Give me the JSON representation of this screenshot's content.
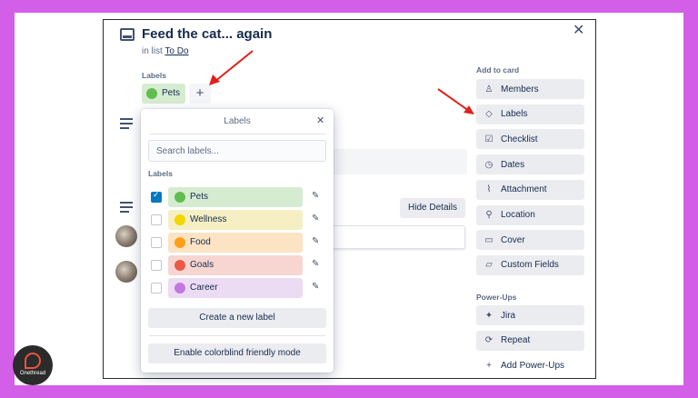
{
  "card": {
    "title": "Feed the cat... again",
    "in_list_prefix": "in list",
    "list_name": "To Do",
    "close_glyph": "✕",
    "labels_heading": "Labels",
    "current_label": "Pets",
    "add_label_glyph": "+",
    "hide_details_label": "Hide Details"
  },
  "sidebar": {
    "add_to_card_heading": "Add to card",
    "buttons": [
      {
        "label": "Members",
        "icon": "person-icon",
        "glyph": "♙"
      },
      {
        "label": "Labels",
        "icon": "tag-icon",
        "glyph": "◇"
      },
      {
        "label": "Checklist",
        "icon": "checklist-icon",
        "glyph": "☑"
      },
      {
        "label": "Dates",
        "icon": "clock-icon",
        "glyph": "◷"
      },
      {
        "label": "Attachment",
        "icon": "paperclip-icon",
        "glyph": "⌇"
      },
      {
        "label": "Location",
        "icon": "pin-icon",
        "glyph": "⚲"
      },
      {
        "label": "Cover",
        "icon": "cover-icon",
        "glyph": "▭"
      },
      {
        "label": "Custom Fields",
        "icon": "folder-icon",
        "glyph": "▱"
      }
    ],
    "powerups_heading": "Power-Ups",
    "powerups": [
      {
        "label": "Jira",
        "icon": "jira-icon",
        "glyph": "✦"
      },
      {
        "label": "Repeat",
        "icon": "repeat-icon",
        "glyph": "⟳"
      },
      {
        "label": "Add Power-Ups",
        "icon": "plus-icon",
        "glyph": "+"
      }
    ]
  },
  "popover": {
    "title": "Labels",
    "close_glyph": "✕",
    "search_placeholder": "Search labels...",
    "section_heading": "Labels",
    "labels": [
      {
        "name": "Pets",
        "checked": true,
        "bar_color": "#d6ecd1",
        "dot_color": "#61bd4f"
      },
      {
        "name": "Wellness",
        "checked": false,
        "bar_color": "#f5efc3",
        "dot_color": "#f2d600"
      },
      {
        "name": "Food",
        "checked": false,
        "bar_color": "#fbe3c3",
        "dot_color": "#ff9f1a"
      },
      {
        "name": "Goals",
        "checked": false,
        "bar_color": "#f7d6d2",
        "dot_color": "#eb5a46"
      },
      {
        "name": "Career",
        "checked": false,
        "bar_color": "#ecdcf3",
        "dot_color": "#c377e0"
      }
    ],
    "create_label": "Create a new label",
    "colorblind_label": "Enable colorblind friendly mode"
  },
  "watermark": {
    "text": "Onethread"
  },
  "colors": {
    "annotation_arrow": "#e0211a",
    "page_background": "#d35ee8"
  }
}
